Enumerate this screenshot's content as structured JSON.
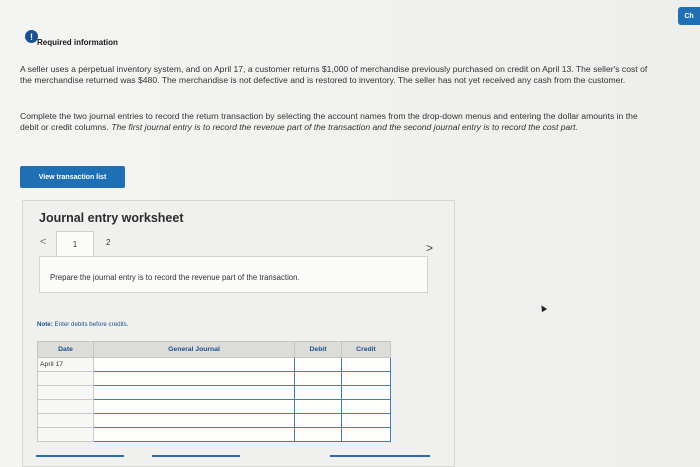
{
  "corner_badge": "Ch",
  "header": {
    "info_icon_glyph": "!",
    "title": "Required information"
  },
  "paragraph1": "A seller uses a perpetual inventory system, and on April 17, a customer returns $1,000 of merchandise previously purchased on credit on April 13. The seller's cost of the merchandise returned was $480. The merchandise is not defective and is restored to inventory. The seller has not yet received any cash from the customer.",
  "paragraph2": {
    "plain": "Complete the two journal entries to record the return transaction by selecting the account names from the drop-down menus and entering the dollar amounts in the debit or credit columns. ",
    "italic": "The first journal entry is to record the revenue part of the transaction and the second journal entry is to record the cost part."
  },
  "view_button_label": "View transaction list",
  "worksheet": {
    "title": "Journal entry worksheet",
    "nav_prev": "<",
    "nav_next": ">",
    "tabs": [
      "1",
      "2"
    ],
    "prompt": "Prepare the journal entry is to record the revenue part of the transaction.",
    "note_label": "Note:",
    "note_text": "Enter debits before credits.",
    "table": {
      "headers": [
        "Date",
        "General Journal",
        "Debit",
        "Credit"
      ],
      "rows": [
        [
          "April 17",
          "",
          "",
          ""
        ],
        [
          "",
          "",
          "",
          ""
        ],
        [
          "",
          "",
          "",
          ""
        ],
        [
          "",
          "",
          "",
          ""
        ],
        [
          "",
          "",
          "",
          ""
        ],
        [
          "",
          "",
          "",
          ""
        ]
      ]
    }
  },
  "colors": {
    "accent": "#1f6fb5",
    "link": "#1d4f91",
    "input_border": "#3b7cc3"
  }
}
